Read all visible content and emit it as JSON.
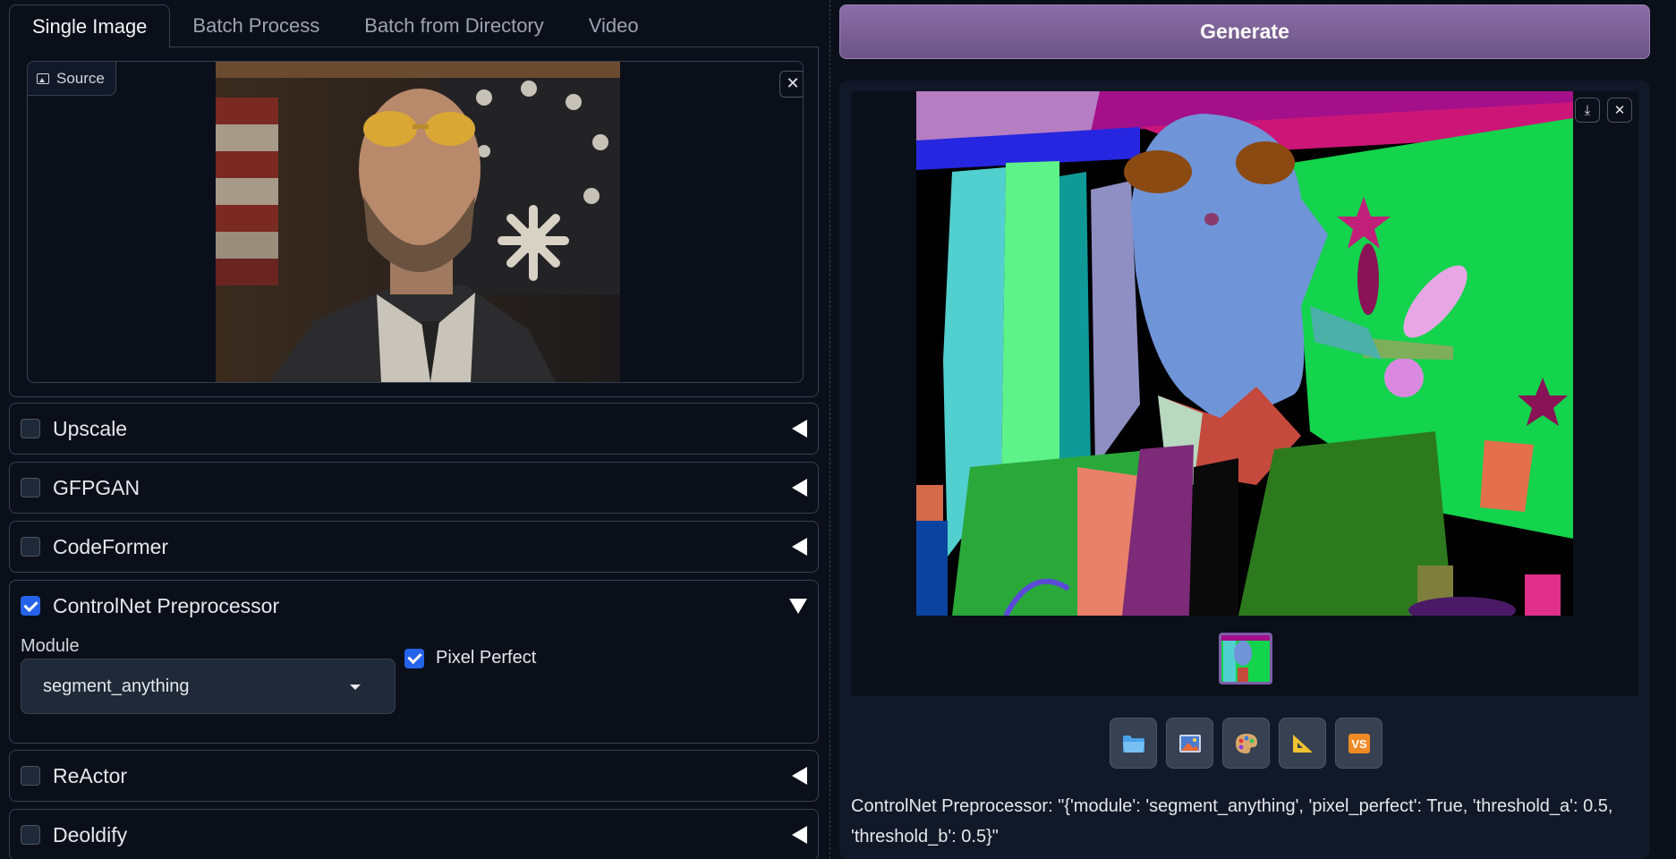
{
  "tabs": [
    "Single Image",
    "Batch Process",
    "Batch from Directory",
    "Video"
  ],
  "source": {
    "label": "Source"
  },
  "accordions": {
    "upscale": {
      "label": "Upscale",
      "checked": false
    },
    "gfpgan": {
      "label": "GFPGAN",
      "checked": false
    },
    "codeformer": {
      "label": "CodeFormer",
      "checked": false
    },
    "controlnet": {
      "label": "ControlNet Preprocessor",
      "checked": true,
      "module_label": "Module",
      "module_value": "segment_anything",
      "pixel_perfect_label": "Pixel Perfect",
      "pixel_perfect": true
    },
    "reactor": {
      "label": "ReActor",
      "checked": false
    },
    "deoldify": {
      "label": "Deoldify",
      "checked": false
    }
  },
  "generate": {
    "label": "Generate"
  },
  "toolbar": [
    "folder-icon",
    "image-icon",
    "palette-icon",
    "ruler-icon",
    "vscode-icon"
  ],
  "info": "ControlNet Preprocessor: \"{'module': 'segment_anything', 'pixel_perfect': True, 'threshold_a': 0.5, 'threshold_b': 0.5}\"",
  "colors": {
    "generate": "#7b6196",
    "checkbox": "#2563eb",
    "thumb_border": "#7c5ea8"
  }
}
